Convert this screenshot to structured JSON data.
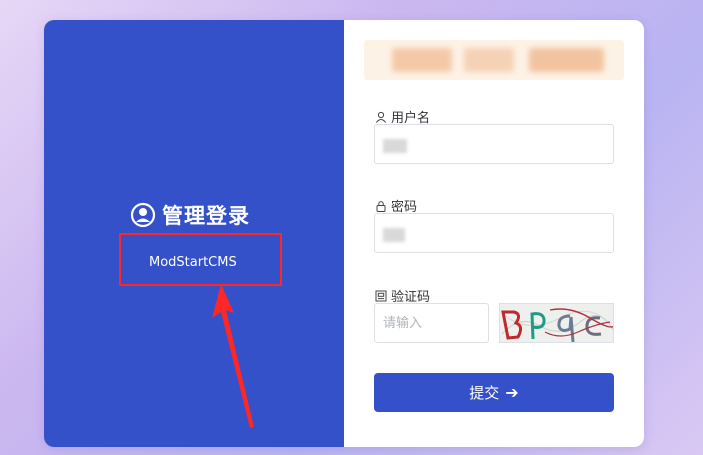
{
  "left_panel": {
    "title": "管理登录",
    "site_name": "ModStartCMS"
  },
  "form": {
    "username_label": "用户名",
    "password_label": "密码",
    "captcha_label": "验证码",
    "captcha_placeholder": "请输入",
    "submit_label": "提交"
  },
  "icons": {
    "title": "user-circle-icon",
    "username": "user-icon",
    "password": "lock-icon",
    "captcha": "captcha-icon",
    "submit": "arrow-right-icon"
  },
  "colors": {
    "primary": "#3451c9",
    "highlight": "#ff2626"
  }
}
